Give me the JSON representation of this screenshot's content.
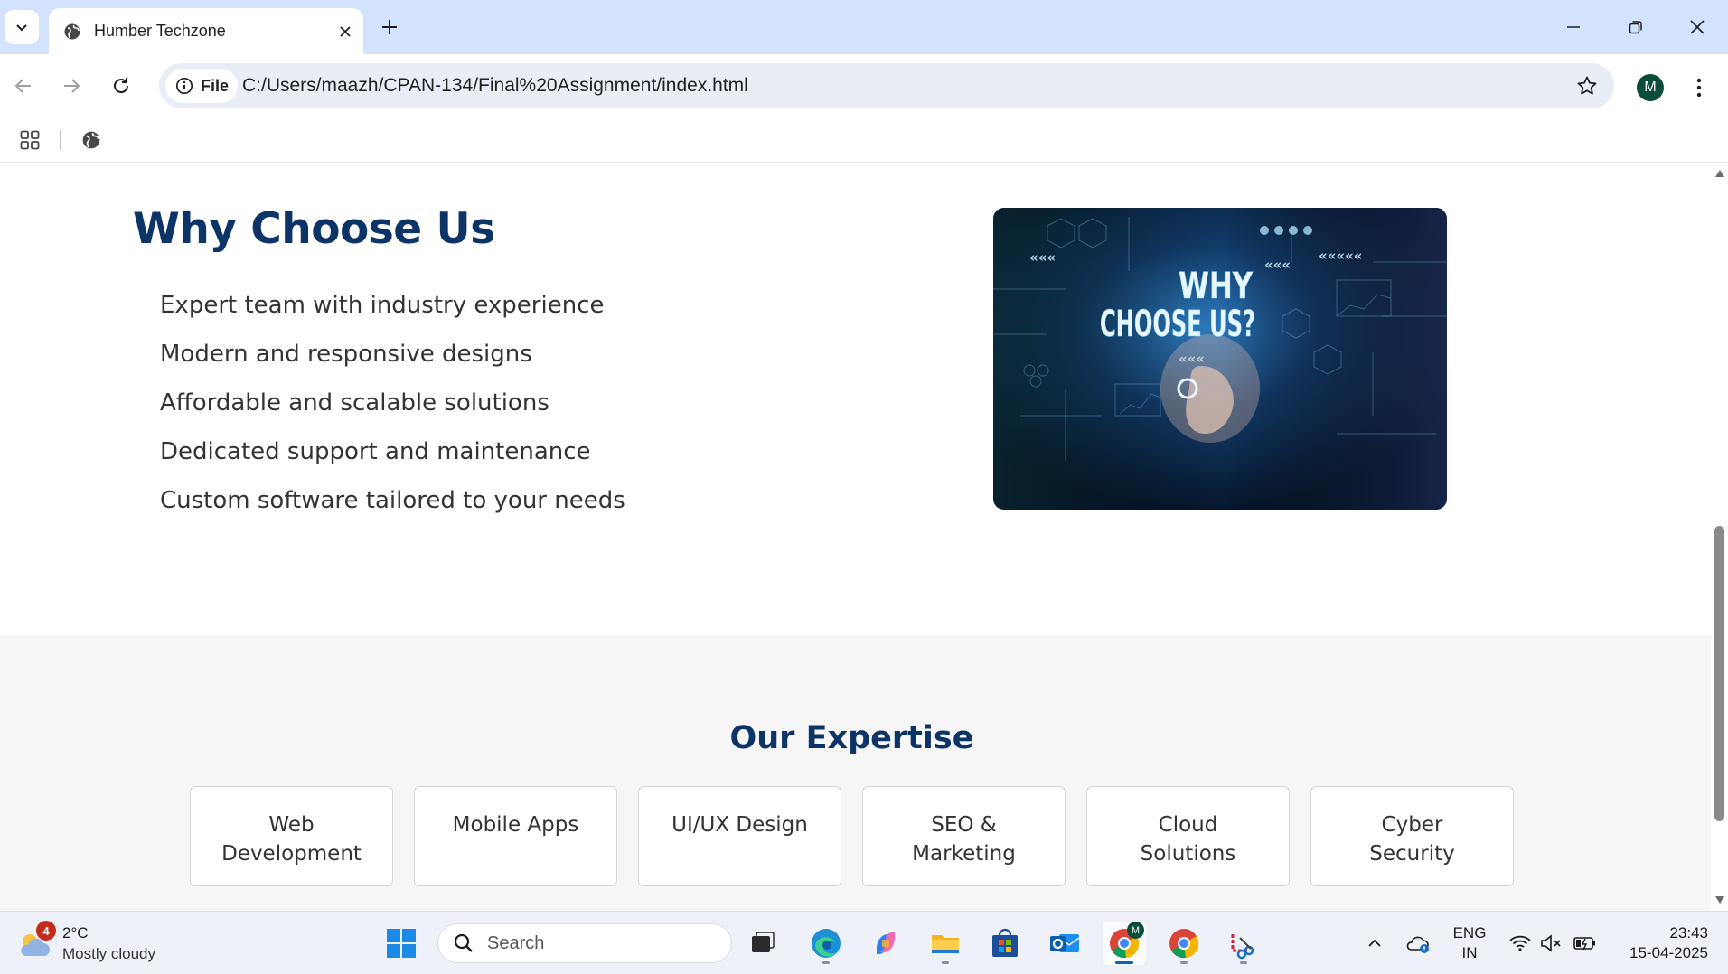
{
  "browser": {
    "tab_title": "Humber Techzone",
    "chip_label": "File",
    "url": "C:/Users/maazh/CPAN-134/Final%20Assignment/index.html",
    "profile_initial": "M"
  },
  "page": {
    "why": {
      "title": "Why Choose Us",
      "items": [
        "Expert team with industry experience",
        "Modern and responsive designs",
        "Affordable and scalable solutions",
        "Dedicated support and maintenance",
        "Custom software tailored to your needs"
      ],
      "image_text": [
        "WHY",
        "CHOOSE US?"
      ]
    },
    "expertise": {
      "title": "Our Expertise",
      "cards": [
        "Web Development",
        "Mobile Apps",
        "UI/UX Design",
        "SEO & Marketing",
        "Cloud Solutions",
        "Cyber Security"
      ]
    }
  },
  "taskbar": {
    "weather_badge": "4",
    "weather_temp": "2°C",
    "weather_desc": "Mostly cloudy",
    "search_label": "Search",
    "lang_line1": "ENG",
    "lang_line2": "IN",
    "time": "23:43",
    "date": "15-04-2025",
    "chrome_profile_badge": "M"
  },
  "colors": {
    "heading": "#0d3466",
    "tabstrip": "#d3e3fd",
    "omnibox": "#e9eef6",
    "section_alt_bg": "#f6f6f6"
  }
}
